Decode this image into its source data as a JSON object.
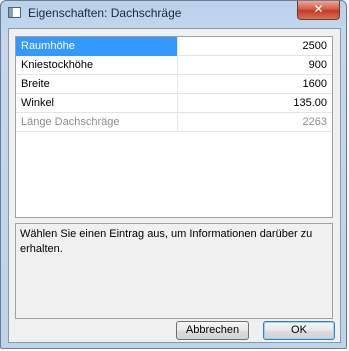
{
  "window": {
    "title": "Eigenschaften: Dachschräge",
    "close_label": "✕"
  },
  "properties": {
    "rows": [
      {
        "name": "Raumhöhe",
        "value": "2500"
      },
      {
        "name": "Kniestockhöhe",
        "value": "900"
      },
      {
        "name": "Breite",
        "value": "1600"
      },
      {
        "name": "Winkel",
        "value": "135.00"
      },
      {
        "name": "Länge Dachschräge",
        "value": "2263"
      }
    ]
  },
  "description": {
    "text": "Wählen Sie einen Eintrag aus, um Informationen darüber zu erhalten."
  },
  "buttons": {
    "cancel_label": "Abbrechen",
    "ok_label": "OK"
  },
  "colors": {
    "selection": "#3399ff",
    "readonly_text": "#8d8d8d",
    "close_button": "#c33a22"
  }
}
